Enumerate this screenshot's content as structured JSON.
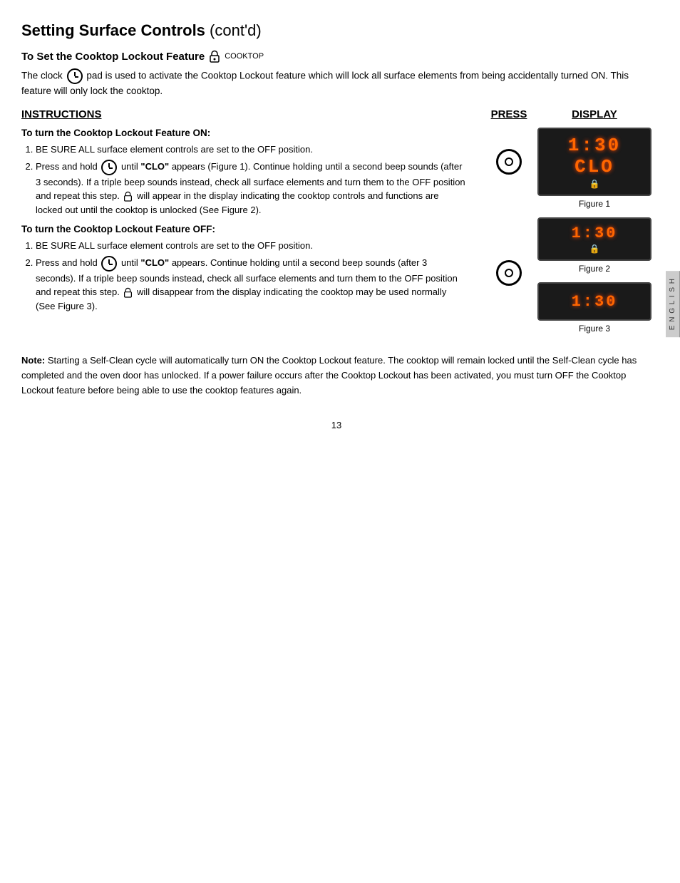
{
  "page": {
    "title": "Setting Surface Controls",
    "title_contd": "(cont'd)",
    "section_header": "To Set the Cooktop Lockout Feature",
    "cooktop_label": "Cooktop",
    "intro": "pad is used to activate the Cooktop Lockout feature which will lock all surface elements from being accidentally turned ON. This feature will only lock the cooktop.",
    "intro_prefix": "The clock",
    "columns": {
      "instructions": "INSTRUCTIONS",
      "press": "PRESS",
      "display": "DISPLAY"
    },
    "on_section": {
      "title": "To turn the Cooktop Lockout Feature ON:",
      "step1": "BE SURE ALL surface element controls are set to the OFF position.",
      "step2_prefix": "Press and hold",
      "step2_bold": "\"CLO\"",
      "step2_mid": "until",
      "step2_text": " appears (Figure 1). Continue holding until a second beep sounds (after 3 seconds). If a triple beep sounds instead, check all surface elements and turn them to the OFF position and repeat this step.",
      "step2_suffix": "will appear in the display indicating the cooktop controls and functions are locked out until the cooktop is unlocked (See Figure 2)."
    },
    "off_section": {
      "title": "To turn the Cooktop Lockout Feature OFF:",
      "step1": "BE SURE ALL surface element controls are set to the OFF position.",
      "step2_prefix": "Press and hold",
      "step2_bold": "\"CLO\"",
      "step2_text": " appears. Continue holding until a second beep sounds (after 3 seconds). If a triple beep sounds instead, check all surface elements and turn them to the OFF position and repeat this step.",
      "step2_suffix": "will disappear from the display indicating the cooktop may be used normally (See Figure 3)."
    },
    "figures": [
      {
        "id": "figure1",
        "label": "Figure 1",
        "display_main": "1:30 CLO",
        "display_sub": "🔒"
      },
      {
        "id": "figure2",
        "label": "Figure 2",
        "display_main": "1:30",
        "display_sub": "🔒"
      },
      {
        "id": "figure3",
        "label": "Figure 3",
        "display_main": "1:30",
        "display_sub": ""
      }
    ],
    "note": {
      "bold": "Note:",
      "text": " Starting a Self-Clean cycle will automatically turn ON the Cooktop Lockout feature. The cooktop will remain locked until the Self-Clean cycle has completed and the oven door has unlocked. If a power failure occurs after the Cooktop Lockout has been activated, you must turn OFF the Cooktop Lockout feature before being able to use the cooktop features again."
    },
    "side_tab": "E N G L I S H",
    "page_number": "13"
  }
}
